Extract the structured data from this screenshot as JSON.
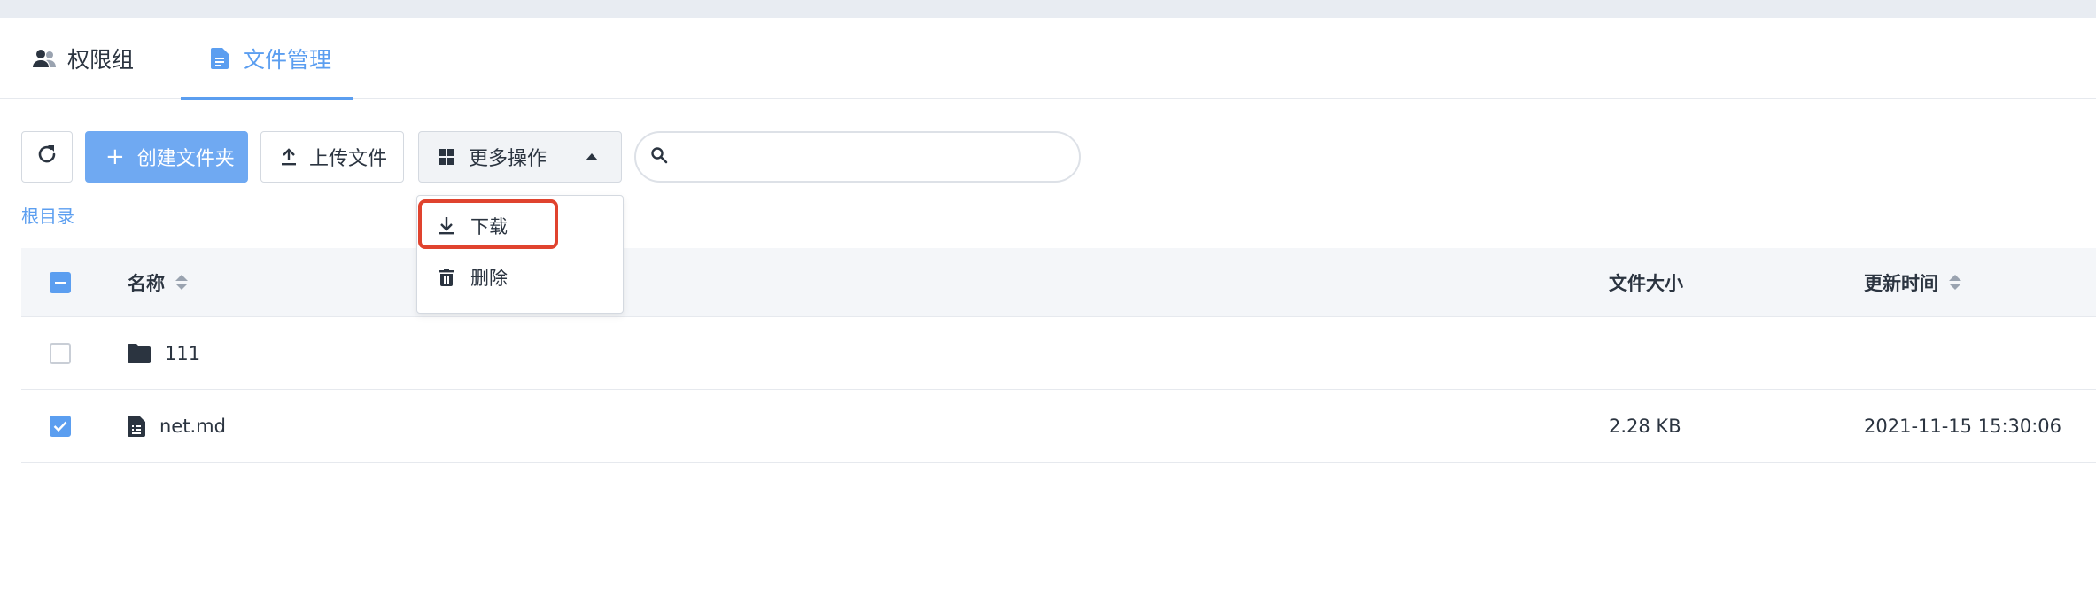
{
  "tabs": [
    {
      "label": "权限组",
      "icon": "users-icon",
      "active": false
    },
    {
      "label": "文件管理",
      "icon": "document-icon",
      "active": true
    }
  ],
  "toolbar": {
    "refresh_icon": "refresh-icon",
    "create_folder_label": "创建文件夹",
    "upload_label": "上传文件",
    "more_actions_label": "更多操作"
  },
  "search": {
    "placeholder": "",
    "value": ""
  },
  "breadcrumb": {
    "root": "根目录"
  },
  "table": {
    "columns": {
      "name": "名称",
      "size": "文件大小",
      "updated": "更新时间"
    },
    "rows": [
      {
        "type": "folder",
        "name": "111",
        "size": "",
        "updated": "",
        "checked": false
      },
      {
        "type": "file",
        "name": "net.md",
        "size": "2.28 KB",
        "updated": "2021-11-15 15:30:06",
        "checked": true
      }
    ]
  },
  "dropdown": {
    "items": [
      {
        "label": "下载",
        "icon": "download-icon",
        "highlighted": true
      },
      {
        "label": "删除",
        "icon": "trash-icon",
        "highlighted": false
      }
    ]
  },
  "colors": {
    "accent": "#5b9ef0",
    "primary_button": "#6fa9f2",
    "highlight_border": "#e0432e",
    "text": "#2b3440"
  }
}
